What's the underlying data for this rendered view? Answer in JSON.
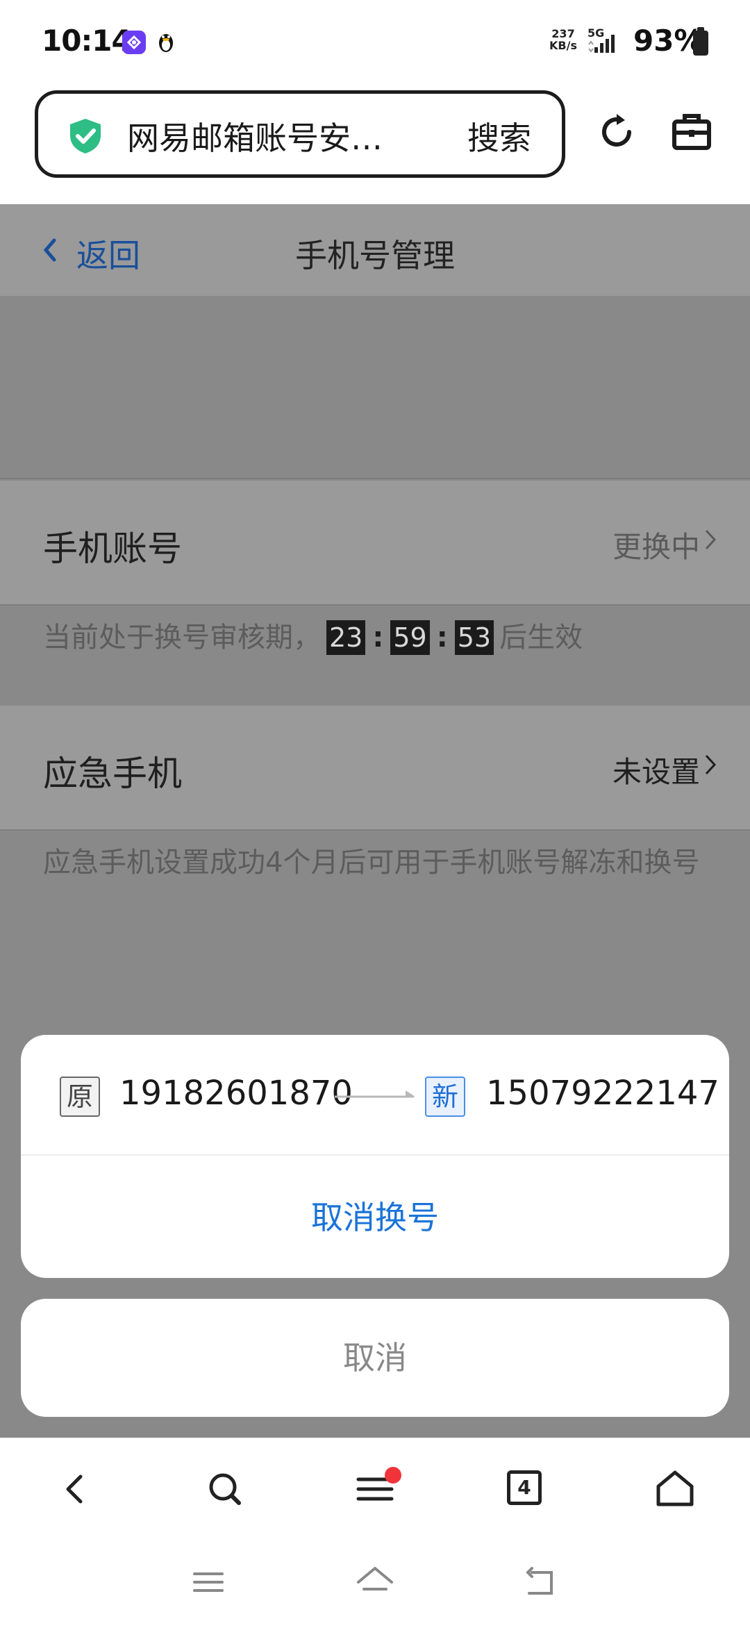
{
  "status_bar": {
    "time": "10:14",
    "net_speed_value": "237",
    "net_speed_unit": "KB/s",
    "network": "5G",
    "battery": "93%"
  },
  "browser": {
    "url_text": "网易邮箱账号安…",
    "search_label": "搜索",
    "tab_count": "4"
  },
  "page": {
    "back_label": "返回",
    "title": "手机号管理",
    "phone_account": {
      "label": "手机账号",
      "status": "更换中"
    },
    "review_notice": {
      "prefix": "当前处于换号审核期，",
      "hours": "23",
      "minutes": "59",
      "seconds": "53",
      "suffix": "后生效",
      "separator": ":"
    },
    "emergency_phone": {
      "label": "应急手机",
      "status": "未设置"
    },
    "emergency_note": "应急手机设置成功4个月后可用于手机账号解冻和换号"
  },
  "action_sheet": {
    "old_tag": "原",
    "old_number": "19182601870",
    "new_tag": "新",
    "new_number": "15079222147",
    "cancel_change_label": "取消换号",
    "cancel_label": "取消"
  },
  "colors": {
    "accent_blue": "#1a73d8",
    "shield_green": "#2ebd85",
    "badge_red": "#f0343a"
  }
}
